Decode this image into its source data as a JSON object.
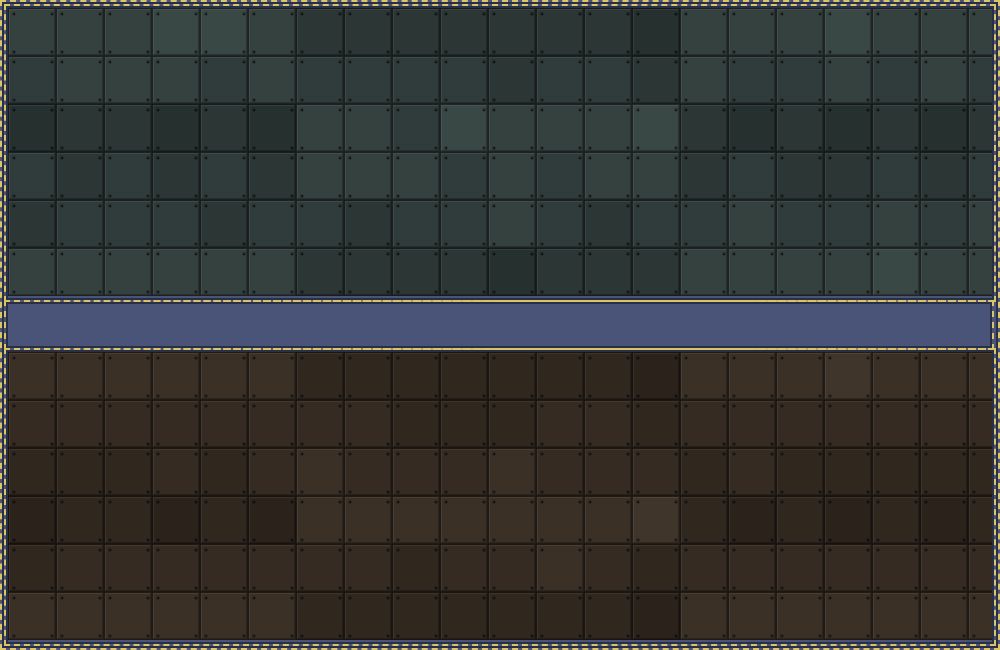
{
  "palette": {
    "top_tiles": [
      "#26302f",
      "#2b3635",
      "#303c3b",
      "#35413f",
      "#394745"
    ],
    "bottom_tiles": [
      "#2b221b",
      "#30271f",
      "#352b22",
      "#3a3026",
      "#40352a"
    ],
    "divider": "#4a5478",
    "rope": "#d9c46a"
  },
  "zones": {
    "top": {
      "rows": [
        [
          3,
          3,
          3,
          4,
          4,
          3,
          1,
          1,
          1,
          1,
          1,
          1,
          1,
          0,
          3,
          3,
          3,
          4,
          3,
          3,
          3
        ],
        [
          2,
          3,
          3,
          3,
          2,
          3,
          2,
          2,
          2,
          2,
          1,
          2,
          2,
          1,
          3,
          2,
          2,
          3,
          2,
          3,
          2
        ],
        [
          0,
          1,
          1,
          0,
          1,
          0,
          3,
          3,
          2,
          4,
          3,
          3,
          3,
          4,
          1,
          0,
          1,
          0,
          1,
          0,
          1
        ],
        [
          2,
          1,
          2,
          1,
          2,
          1,
          3,
          3,
          3,
          2,
          3,
          2,
          3,
          3,
          1,
          2,
          1,
          1,
          2,
          1,
          2
        ],
        [
          1,
          2,
          2,
          2,
          1,
          2,
          2,
          1,
          2,
          2,
          3,
          2,
          1,
          2,
          2,
          3,
          2,
          2,
          3,
          2,
          3
        ],
        [
          3,
          3,
          3,
          3,
          3,
          3,
          1,
          1,
          1,
          1,
          0,
          1,
          1,
          1,
          3,
          3,
          3,
          3,
          4,
          3,
          3
        ]
      ]
    },
    "bottom": {
      "rows": [
        [
          3,
          3,
          3,
          3,
          3,
          3,
          1,
          1,
          1,
          1,
          1,
          1,
          1,
          0,
          3,
          3,
          3,
          4,
          3,
          3,
          3
        ],
        [
          2,
          2,
          2,
          2,
          2,
          2,
          2,
          2,
          1,
          1,
          1,
          2,
          2,
          1,
          2,
          2,
          2,
          2,
          2,
          2,
          2
        ],
        [
          1,
          1,
          1,
          2,
          1,
          2,
          3,
          2,
          2,
          2,
          3,
          2,
          2,
          2,
          1,
          2,
          1,
          1,
          1,
          1,
          1
        ],
        [
          0,
          1,
          1,
          0,
          1,
          0,
          3,
          3,
          3,
          3,
          3,
          3,
          3,
          4,
          1,
          0,
          1,
          0,
          1,
          0,
          1
        ],
        [
          1,
          2,
          2,
          2,
          2,
          2,
          2,
          2,
          1,
          2,
          2,
          3,
          2,
          1,
          2,
          2,
          2,
          2,
          2,
          2,
          2
        ],
        [
          3,
          3,
          3,
          3,
          3,
          3,
          1,
          1,
          1,
          1,
          1,
          1,
          1,
          0,
          3,
          3,
          3,
          3,
          3,
          3,
          3
        ]
      ]
    }
  }
}
